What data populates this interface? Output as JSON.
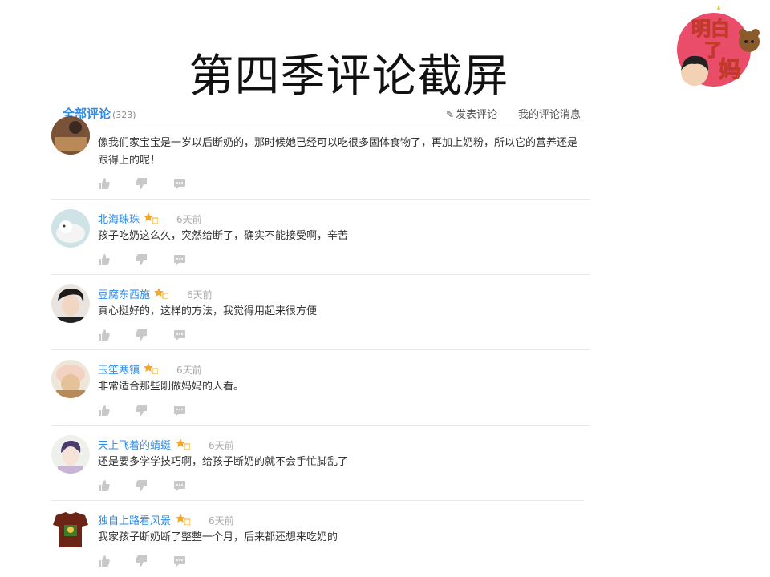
{
  "slide": {
    "title": "第四季评论截屏"
  },
  "logo": {
    "text": "明白了妈"
  },
  "header": {
    "tab_label": "全部评论",
    "tab_count": "(323)",
    "post_comment": "发表评论",
    "my_messages": "我的评论消息"
  },
  "comments": [
    {
      "name": "",
      "time": "",
      "text": "像我们家宝宝是一岁以后断奶的，那时候她已经可以吃很多固体食物了，再加上奶粉，所以它的营养还是跟得上的呢！"
    },
    {
      "name": "北海珠珠",
      "time": "6天前",
      "text": "孩子吃奶这么久，突然给断了，确实不能接受啊，辛苦"
    },
    {
      "name": "豆腐东西施",
      "time": "6天前",
      "text": "真心挺好的，这样的方法，我觉得用起来很方便"
    },
    {
      "name": "玉笙寒镇",
      "time": "6天前",
      "text": "非常适合那些刚做妈妈的人看。"
    },
    {
      "name": "天上飞着的蜻蜓",
      "time": "6天前",
      "text": "还是要多学学技巧啊，给孩子断奶的就不会手忙脚乱了"
    },
    {
      "name": "独自上路看风景",
      "time": "6天前",
      "text": "我家孩子断奶断了整整一个月，后来都还想来吃奶的"
    }
  ],
  "colors": {
    "accent": "#2e8be8",
    "badge": "#f5a623",
    "text": "#333333",
    "muted": "#a9a9a9"
  },
  "icons": [
    "like-icon",
    "dislike-icon",
    "reply-icon",
    "pen-icon",
    "vip-badge-icon"
  ]
}
